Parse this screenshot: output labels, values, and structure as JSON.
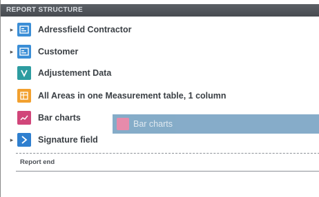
{
  "panel": {
    "title": "REPORT STRUCTURE"
  },
  "tree": {
    "items": [
      {
        "label": "Adressfield Contractor",
        "icon": "address-card-icon",
        "has_children": true,
        "icon_color": "#3b8ed6"
      },
      {
        "label": "Customer",
        "icon": "address-card-icon",
        "has_children": true,
        "icon_color": "#3b8ed6"
      },
      {
        "label": "Adjustement Data",
        "icon": "check-shield-icon",
        "has_children": false,
        "icon_color": "#2d9ca0"
      },
      {
        "label": "All Areas in one Measurement table, 1 column",
        "icon": "table-icon",
        "has_children": false,
        "icon_color": "#f2a02e"
      },
      {
        "label": "Bar charts",
        "icon": "bar-chart-icon",
        "has_children": false,
        "icon_color": "#d1467a"
      },
      {
        "label": "Signature field",
        "icon": "signature-icon",
        "has_children": true,
        "icon_color": "#2f7fcf"
      }
    ]
  },
  "drag_ghost": {
    "label": "Bar charts",
    "icon": "bar-chart-icon",
    "icon_color": "#e585a7",
    "color": "#7fa8c6"
  },
  "footer": {
    "report_end_label": "Report end"
  },
  "colors": {
    "header_bg": "#4d5157",
    "header_text": "#d7dbe0",
    "item_text": "#3a3f44"
  }
}
